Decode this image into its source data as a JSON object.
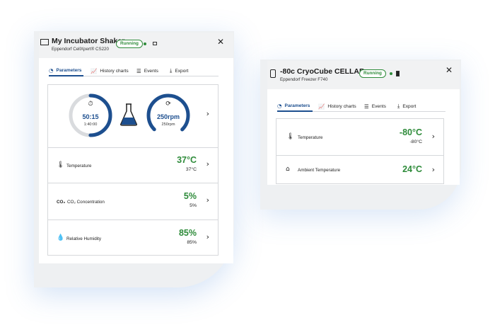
{
  "left_window": {
    "title": "My Incubator Shaker",
    "subtitle": "Eppendorf CellXpert® CS220",
    "status": "Running",
    "tabs": [
      {
        "label": "Parameters",
        "icon": "gauge-icon"
      },
      {
        "label": "History charts",
        "icon": "line-chart-icon"
      },
      {
        "label": "Events",
        "icon": "list-icon"
      },
      {
        "label": "Export",
        "icon": "download-icon"
      }
    ],
    "timer": {
      "value": "50:15",
      "total": "1:40:00",
      "progress": 0.5
    },
    "shaker": {
      "value": "250rpm",
      "setpoint": "250rpm",
      "progress": 1.0
    },
    "rows": [
      {
        "label": "Temperature",
        "value": "37°C",
        "setpoint": "37°C",
        "icon": "thermometer-icon"
      },
      {
        "label": "CO₂ Concentration",
        "icon_text": "CO₂",
        "value": "5%",
        "setpoint": "5%",
        "icon": "co2-icon"
      },
      {
        "label": "Relative Humidity",
        "value": "85%",
        "setpoint": "85%",
        "icon": "droplet-icon"
      }
    ]
  },
  "right_window": {
    "title": "-80c CryoCube CELLAR",
    "subtitle": "Eppendorf Freezer F740",
    "status": "Running",
    "tabs": [
      {
        "label": "Parameters",
        "icon": "gauge-icon"
      },
      {
        "label": "History charts",
        "icon": "line-chart-icon"
      },
      {
        "label": "Events",
        "icon": "list-icon"
      },
      {
        "label": "Export",
        "icon": "download-icon"
      }
    ],
    "rows": [
      {
        "label": "Temperature",
        "value": "-80°C",
        "setpoint": "-80°C",
        "icon": "thermometer-icon"
      },
      {
        "label": "Ambient Temperature",
        "value": "24°C",
        "icon": "house-thermometer-icon"
      }
    ]
  },
  "colors": {
    "accent": "#1d4f8f",
    "ok": "#2e8b3a",
    "ring_track": "#d9dbde"
  }
}
